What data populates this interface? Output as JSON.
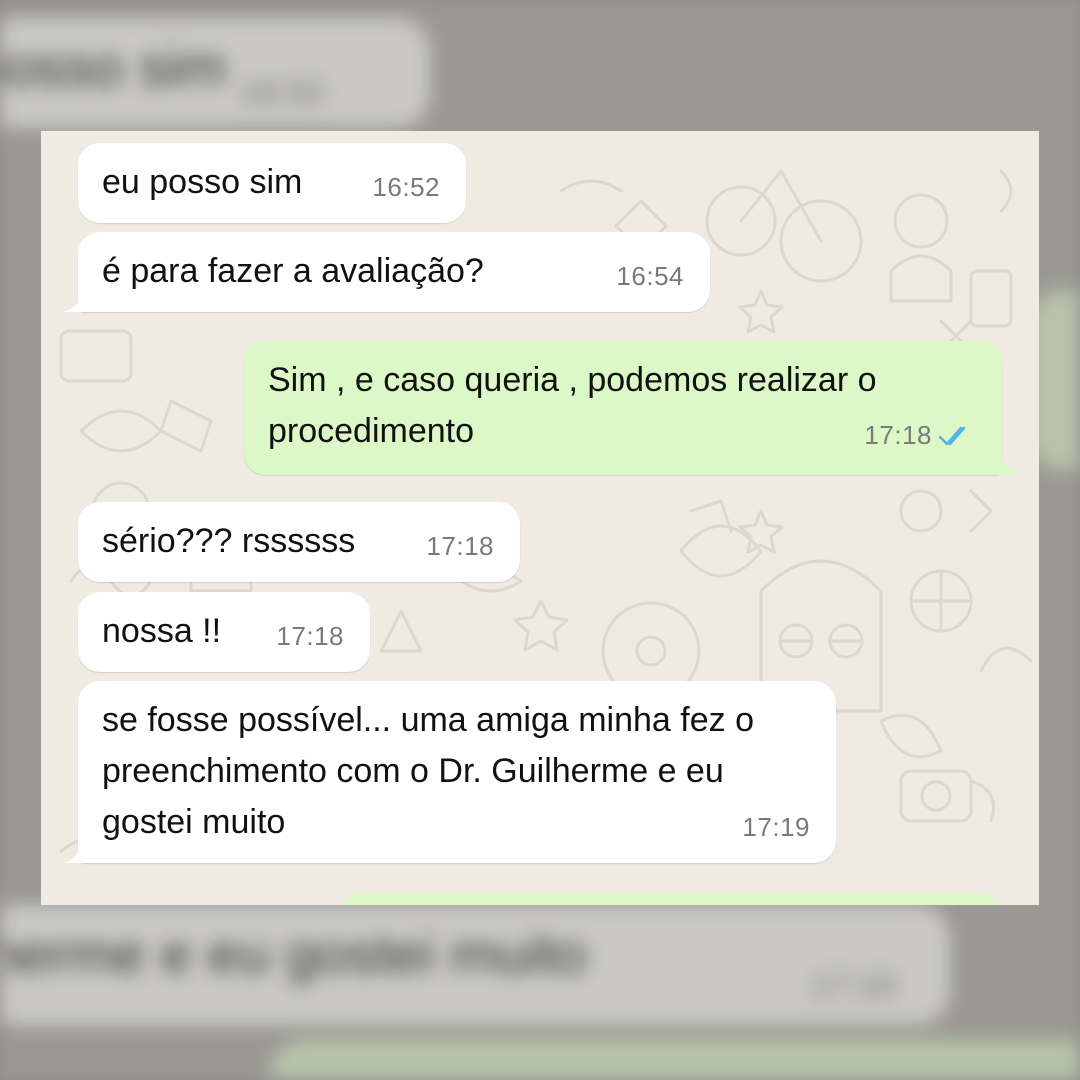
{
  "background": {
    "messages": [
      {
        "text": "posso sim",
        "time": "16:52"
      },
      {
        "text": "lherme e eu gostei muito",
        "time": "17:19"
      }
    ]
  },
  "chat": {
    "messages": [
      {
        "direction": "incoming",
        "text": "eu posso sim",
        "time": "16:52"
      },
      {
        "direction": "incoming",
        "text": "é para fazer a avaliação?",
        "time": "16:54"
      },
      {
        "direction": "outgoing",
        "text": "Sim , e caso queria , podemos realizar o procedimento",
        "time": "17:18",
        "status": "read",
        "status_icon": "double-check-icon"
      },
      {
        "direction": "incoming",
        "text": "sério??? rssssss",
        "time": "17:18"
      },
      {
        "direction": "incoming",
        "text": "nossa !!",
        "time": "17:18"
      },
      {
        "direction": "incoming",
        "text": "se fosse possível... uma amiga minha fez o preenchimento com o Dr. Guilherme e eu gostei muito",
        "time": "17:19"
      }
    ]
  },
  "colors": {
    "incoming_bubble": "#ffffff",
    "outgoing_bubble": "#dcf8c6",
    "chat_background": "#efeae2",
    "read_ticks": "#4fb6ec"
  }
}
